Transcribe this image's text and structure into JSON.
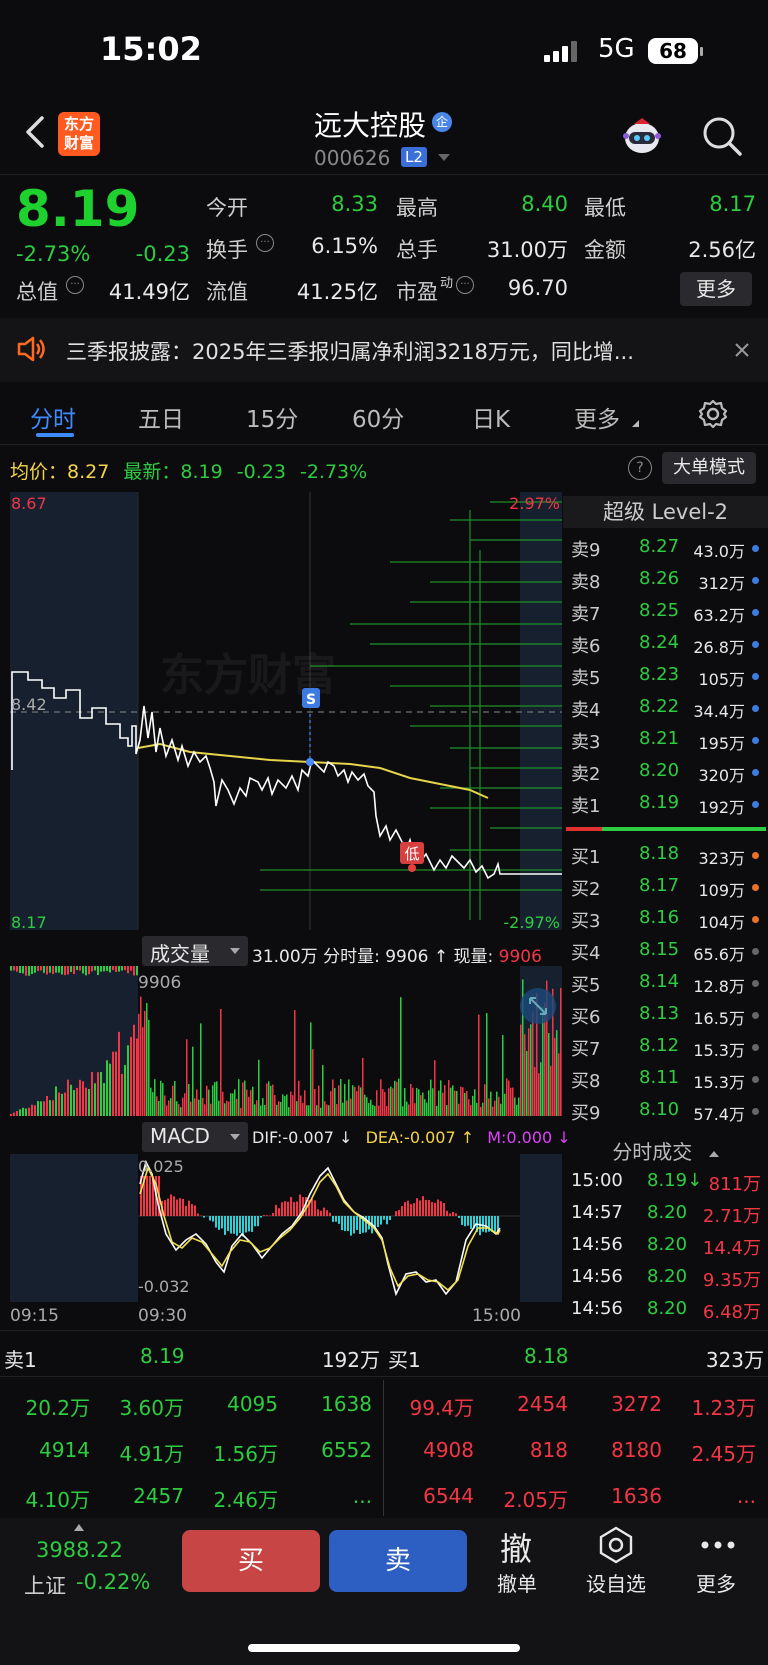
{
  "status_bar": {
    "time": "15:02",
    "network": "5G",
    "battery": "68"
  },
  "header": {
    "stock_name": "远大控股",
    "badge": "企",
    "code": "000626",
    "level_badge": "L2",
    "logo_text": "东方财富"
  },
  "quote": {
    "price": "8.19",
    "change_pct": "-2.73%",
    "change": "-0.23",
    "open_label": "今开",
    "open": "8.33",
    "high_label": "最高",
    "high": "8.40",
    "low_label": "最低",
    "low": "8.17",
    "turnover_label": "换手",
    "turnover": "6.15%",
    "volume_label": "总手",
    "volume": "31.00万",
    "amount_label": "金额",
    "amount": "2.56亿",
    "mktcap_label": "总值",
    "mktcap": "41.49亿",
    "float_label": "流值",
    "float_cap": "41.25亿",
    "pe_label": "市盈",
    "pe_sup": "动",
    "pe": "96.70",
    "more": "更多"
  },
  "notice": {
    "text": "三季报披露：2025年三季报归属净利润3218万元，同比增..."
  },
  "tabs": [
    {
      "label": "分时",
      "active": true
    },
    {
      "label": "五日"
    },
    {
      "label": "15分"
    },
    {
      "label": "60分"
    },
    {
      "label": "日K"
    },
    {
      "label": "更多"
    }
  ],
  "chart_info": {
    "avg_label": "均价：",
    "avg": "8.27",
    "latest_label": "最新：",
    "latest": "8.19",
    "latest_change": "-0.23",
    "latest_pct": "-2.73%",
    "big_order_mode": "大单模式"
  },
  "chart_data": {
    "type": "line",
    "price_axis": {
      "top": "8.67",
      "mid": "8.42",
      "bottom": "8.17",
      "top_pct": "2.97%",
      "bottom_pct": "-2.97%"
    },
    "time_labels": [
      "09:15",
      "09:30",
      "15:00"
    ],
    "markers": {
      "sell": "S",
      "low": "低"
    },
    "volume_panel": {
      "title": "成交量",
      "info": "31.00万 分时量: 9906 ↑ 现量: ",
      "current": "9906",
      "max_label": "9906"
    },
    "macd_panel": {
      "title": "MACD",
      "dif": "DIF:-0.007 ↓",
      "dea": "DEA:-0.007 ↑",
      "m": "M:0.000 ↓",
      "top_label": "0.025",
      "bottom_label": "-0.032"
    }
  },
  "level2": {
    "title": "超级 Level-2",
    "asks": [
      {
        "label": "卖9",
        "price": "8.27",
        "vol": "43.0万"
      },
      {
        "label": "卖8",
        "price": "8.26",
        "vol": "312万"
      },
      {
        "label": "卖7",
        "price": "8.25",
        "vol": "63.2万"
      },
      {
        "label": "卖6",
        "price": "8.24",
        "vol": "26.8万"
      },
      {
        "label": "卖5",
        "price": "8.23",
        "vol": "105万"
      },
      {
        "label": "卖4",
        "price": "8.22",
        "vol": "34.4万"
      },
      {
        "label": "卖3",
        "price": "8.21",
        "vol": "195万"
      },
      {
        "label": "卖2",
        "price": "8.20",
        "vol": "320万"
      },
      {
        "label": "卖1",
        "price": "8.19",
        "vol": "192万"
      }
    ],
    "bids": [
      {
        "label": "买1",
        "price": "8.18",
        "vol": "323万"
      },
      {
        "label": "买2",
        "price": "8.17",
        "vol": "109万"
      },
      {
        "label": "买3",
        "price": "8.16",
        "vol": "104万"
      },
      {
        "label": "买4",
        "price": "8.15",
        "vol": "65.6万"
      },
      {
        "label": "买5",
        "price": "8.14",
        "vol": "12.8万"
      },
      {
        "label": "买6",
        "price": "8.13",
        "vol": "16.5万"
      },
      {
        "label": "买7",
        "price": "8.12",
        "vol": "15.3万"
      },
      {
        "label": "买8",
        "price": "8.11",
        "vol": "15.3万"
      },
      {
        "label": "买9",
        "price": "8.10",
        "vol": "57.4万"
      }
    ],
    "ticks_title": "分时成交",
    "ticks": [
      {
        "time": "15:00",
        "price": "8.19↓",
        "vol": "811万"
      },
      {
        "time": "14:57",
        "price": "8.20",
        "vol": "2.71万"
      },
      {
        "time": "14:56",
        "price": "8.20",
        "vol": "14.4万"
      },
      {
        "time": "14:56",
        "price": "8.20",
        "vol": "9.35万"
      },
      {
        "time": "14:56",
        "price": "8.20",
        "vol": "6.48万"
      }
    ]
  },
  "queue": {
    "sell": {
      "label": "卖1",
      "price": "8.19",
      "vol": "192万",
      "rows": [
        [
          "20.2万",
          "3.60万",
          "4095",
          "1638"
        ],
        [
          "4914",
          "4.91万",
          "1.56万",
          "6552"
        ],
        [
          "4.10万",
          "2457",
          "2.46万",
          "..."
        ]
      ]
    },
    "buy": {
      "label": "买1",
      "price": "8.18",
      "vol": "323万",
      "rows": [
        [
          "99.4万",
          "2454",
          "3272",
          "1.23万"
        ],
        [
          "4908",
          "818",
          "8180",
          "2.45万"
        ],
        [
          "6544",
          "2.05万",
          "1636",
          "..."
        ]
      ]
    }
  },
  "bottom_bar": {
    "index_value": "3988.22",
    "index_name": "上证",
    "index_change": "-0.22%",
    "buy": "买",
    "sell": "卖",
    "cancel_icon_text": "撤",
    "cancel": "撤单",
    "watchlist": "设自选",
    "more": "更多"
  },
  "colors": {
    "up": "#f23645",
    "down": "#2ecc40",
    "avg_line": "#f5d547",
    "accent": "#3d8bff"
  }
}
